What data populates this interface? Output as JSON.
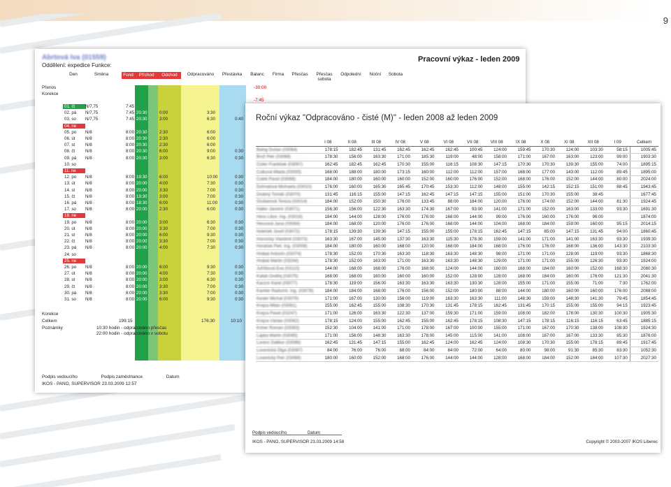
{
  "page": {
    "number": "9"
  },
  "back_doc": {
    "name": "Abrtová Iva (01559)",
    "department": "Oddělení: expedice Funkce:",
    "title": "Pracovní výkaz - leden 2009",
    "headers": [
      "Den",
      "Směna",
      "Fond",
      "Příchod",
      "Odchod",
      "Odpracováno",
      "Přestávka",
      "Balanc",
      "Firma",
      "Přesčas",
      "Přesčas sobota",
      "Odpolední",
      "Noční",
      "Sobota"
    ],
    "prenos_label": "Přenos",
    "korekce_label": "Korekce",
    "balance_1": "-30:00",
    "balance_2": "-7:45",
    "rows": [
      {
        "day": "01. čt",
        "shift": "N/7,75",
        "fond": "7:45",
        "arr": "",
        "dep": "",
        "work": "",
        "pause": "",
        "type": "green"
      },
      {
        "day": "02. pá",
        "shift": "N/7,75",
        "fond": "7:45",
        "arr": "20:30",
        "dep": "0:00",
        "work": "3:30",
        "pause": "",
        "type": ""
      },
      {
        "day": "03. so",
        "shift": "N/7,75",
        "fond": "7:45",
        "arr": "20:30",
        "dep": "3:00",
        "work": "6:30",
        "pause": "0:40",
        "type": ""
      },
      {
        "day": "04. ne",
        "shift": "",
        "fond": "",
        "arr": "",
        "dep": "",
        "work": "",
        "pause": "",
        "type": "hol"
      },
      {
        "day": "05. po",
        "shift": "N/8",
        "fond": "8:00",
        "arr": "20:30",
        "dep": "2:30",
        "work": "6:00",
        "pause": "",
        "type": ""
      },
      {
        "day": "06. út",
        "shift": "N/8",
        "fond": "8:00",
        "arr": "20:30",
        "dep": "2:30",
        "work": "6:00",
        "pause": "",
        "type": ""
      },
      {
        "day": "07. st",
        "shift": "N/8",
        "fond": "8:00",
        "arr": "20:30",
        "dep": "2:30",
        "work": "6:00",
        "pause": "",
        "type": ""
      },
      {
        "day": "08. čt",
        "shift": "N/8",
        "fond": "8:00",
        "arr": "20:30",
        "dep": "6:00",
        "work": "9:00",
        "pause": "0:30",
        "type": ""
      },
      {
        "day": "09. pá",
        "shift": "N/8",
        "fond": "8:00",
        "arr": "20:30",
        "dep": "3:00",
        "work": "6:30",
        "pause": "0:30",
        "type": ""
      },
      {
        "day": "10. so",
        "shift": "",
        "fond": "",
        "arr": "",
        "dep": "",
        "work": "",
        "pause": "",
        "type": ""
      },
      {
        "day": "11. ne",
        "shift": "",
        "fond": "",
        "arr": "",
        "dep": "",
        "work": "",
        "pause": "",
        "type": "hol"
      },
      {
        "day": "12. po",
        "shift": "N/8",
        "fond": "8:00",
        "arr": "19:30",
        "dep": "6:00",
        "work": "10:00",
        "pause": "0:30",
        "type": ""
      },
      {
        "day": "13. út",
        "shift": "N/8",
        "fond": "8:00",
        "arr": "20:00",
        "dep": "4:00",
        "work": "7:30",
        "pause": "0:30",
        "type": ""
      },
      {
        "day": "14. st",
        "shift": "N/8",
        "fond": "8:00",
        "arr": "20:00",
        "dep": "3:30",
        "work": "7:00",
        "pause": "0:30",
        "type": ""
      },
      {
        "day": "15. čt",
        "shift": "N/8",
        "fond": "8:00",
        "arr": "19:30",
        "dep": "3:00",
        "work": "7:00",
        "pause": "0:30",
        "type": ""
      },
      {
        "day": "16. pá",
        "shift": "N/8",
        "fond": "8:00",
        "arr": "18:30",
        "dep": "6:00",
        "work": "11:00",
        "pause": "0:30",
        "type": ""
      },
      {
        "day": "17. so",
        "shift": "N/8",
        "fond": "8:00",
        "arr": "20:00",
        "dep": "2:30",
        "work": "6:00",
        "pause": "0:30",
        "type": ""
      },
      {
        "day": "18. ne",
        "shift": "",
        "fond": "",
        "arr": "",
        "dep": "",
        "work": "",
        "pause": "",
        "type": "hol"
      },
      {
        "day": "19. po",
        "shift": "N/8",
        "fond": "8:00",
        "arr": "20:00",
        "dep": "3:00",
        "work": "6:30",
        "pause": "0:30",
        "type": ""
      },
      {
        "day": "20. út",
        "shift": "N/8",
        "fond": "8:00",
        "arr": "20:00",
        "dep": "3:30",
        "work": "7:00",
        "pause": "0:30",
        "type": ""
      },
      {
        "day": "21. st",
        "shift": "N/8",
        "fond": "8:00",
        "arr": "20:00",
        "dep": "6:00",
        "work": "9:30",
        "pause": "0:30",
        "type": ""
      },
      {
        "day": "22. čt",
        "shift": "N/8",
        "fond": "8:00",
        "arr": "20:00",
        "dep": "3:30",
        "work": "7:00",
        "pause": "0:30",
        "type": ""
      },
      {
        "day": "23. pá",
        "shift": "N/8",
        "fond": "8:00",
        "arr": "20:00",
        "dep": "4:00",
        "work": "7:30",
        "pause": "0:30",
        "type": ""
      },
      {
        "day": "24. so",
        "shift": "",
        "fond": "",
        "arr": "",
        "dep": "",
        "work": "",
        "pause": "",
        "type": ""
      },
      {
        "day": "25. ne",
        "shift": "",
        "fond": "",
        "arr": "",
        "dep": "",
        "work": "",
        "pause": "",
        "type": "hol"
      },
      {
        "day": "26. po",
        "shift": "N/8",
        "fond": "8:00",
        "arr": "20:00",
        "dep": "6:00",
        "work": "9:30",
        "pause": "0:30",
        "type": ""
      },
      {
        "day": "27. út",
        "shift": "N/8",
        "fond": "8:00",
        "arr": "20:00",
        "dep": "4:00",
        "work": "7:30",
        "pause": "0:30",
        "type": ""
      },
      {
        "day": "28. st",
        "shift": "N/8",
        "fond": "8:00",
        "arr": "20:00",
        "dep": "3:00",
        "work": "6:30",
        "pause": "0:30",
        "type": ""
      },
      {
        "day": "29. čt",
        "shift": "N/8",
        "fond": "8:00",
        "arr": "20:00",
        "dep": "3:30",
        "work": "7:00",
        "pause": "0:30",
        "type": ""
      },
      {
        "day": "30. pá",
        "shift": "N/8",
        "fond": "8:00",
        "arr": "20:00",
        "dep": "3:30",
        "work": "7:00",
        "pause": "0:30",
        "type": ""
      },
      {
        "day": "31. so",
        "shift": "N/8",
        "fond": "8:00",
        "arr": "20:00",
        "dep": "6:00",
        "work": "9:30",
        "pause": "0:30",
        "type": ""
      }
    ],
    "korekce2_label": "Korekce",
    "celkem_label": "Celkem",
    "celkem_fond": "199:15",
    "celkem_work": "176:30",
    "celkem_pause": "10:10",
    "poznamky_label": "Poznámky",
    "note_1": "10:30 hodin - odpracováno přesčas",
    "note_2": "22:00 hodin - odpracováno v sobotu",
    "sign_manager": "Podpis vedoucího",
    "sign_employee": "Podpis zaměstnance",
    "sign_date": "Datum",
    "footer": "IKOS - PANO, SUPERVISOR 23.03.2009 12:57"
  },
  "front_doc": {
    "title": "Roční výkaz \"Odpracováno - čisté (M)\" - leden 2008 až leden 2009",
    "columns": [
      "",
      "I 08",
      "II 08",
      "III 08",
      "IV 08",
      "V 08",
      "VI 08",
      "VII 08",
      "VIII 08",
      "IX 08",
      "X 08",
      "XI 08",
      "XII 08",
      "I 09",
      "Celkem"
    ],
    "rows": [
      [
        "Balog Dušan (03064)",
        "178:15",
        "182:45",
        "131:45",
        "162:45",
        "162:45",
        "162:45",
        "100:45",
        "124:00",
        "159:45",
        "170:30",
        "124:00",
        "103:30",
        "58:15",
        "1005:45"
      ],
      [
        "Brož Petr (03066)",
        "178:30",
        "156:00",
        "163:30",
        "171:00",
        "185:30",
        "119:00",
        "48:00",
        "158:00",
        "171:00",
        "167:00",
        "163:00",
        "123:00",
        "99:00",
        "1903:30"
      ],
      [
        "Cizler František (03067)",
        "162:45",
        "182:45",
        "162:45",
        "170:30",
        "155:00",
        "116:15",
        "108:30",
        "147:15",
        "170:30",
        "170:30",
        "139:30",
        "155:00",
        "74:00",
        "1895:15"
      ],
      [
        "Culková Mlada (03005)",
        "168:00",
        "188:00",
        "180:00",
        "173:15",
        "160:00",
        "112:00",
        "112:00",
        "157:00",
        "168:00",
        "177:00",
        "143:00",
        "112:00",
        "89:45",
        "1895:00"
      ],
      [
        "Culek Pavel (03068)",
        "184:00",
        "180:00",
        "160:00",
        "160:00",
        "152:00",
        "160:00",
        "176:00",
        "152:00",
        "168:00",
        "176:00",
        "152:00",
        "144:00",
        "80:00",
        "2024:00"
      ],
      [
        "Dohnalová Michaela (03010)",
        "176:00",
        "160:00",
        "165:30",
        "165:45",
        "170:45",
        "153:30",
        "112:00",
        "148:00",
        "155:00",
        "142:15",
        "152:15",
        "151:00",
        "88:45",
        "1943:45"
      ],
      [
        "Drobný Tomáš (03070)",
        "131:45",
        "116:15",
        "155:00",
        "147:15",
        "162:45",
        "147:15",
        "147:15",
        "155:00",
        "151:00",
        "170:30",
        "155:00",
        "38:45",
        "",
        "1677:45"
      ],
      [
        "Grubarová Tereza (03014)",
        "184:00",
        "152:00",
        "150:30",
        "176:00",
        "133:45",
        "88:00",
        "184:00",
        "120:00",
        "176:00",
        "174:00",
        "152:00",
        "144:00",
        "81:30",
        "1924:45"
      ],
      [
        "Haller Jaromír (03071)",
        "156:30",
        "156:00",
        "122:30",
        "163:30",
        "174:30",
        "167:00",
        "93:00",
        "141:00",
        "171:00",
        "152:00",
        "163:00",
        "133:00",
        "93:30",
        "1691:30"
      ],
      [
        "Hess Libor, Ing. (03016)",
        "184:00",
        "144:00",
        "128:00",
        "176:00",
        "176:00",
        "168:00",
        "144:00",
        "99:00",
        "176:00",
        "160:00",
        "176:00",
        "96:00",
        "",
        "1874:00"
      ],
      [
        "Hessová Jana (03084)",
        "184:00",
        "168:00",
        "120:00",
        "176:00",
        "176:00",
        "168:00",
        "144:00",
        "104:00",
        "168:00",
        "184:00",
        "159:00",
        "160:00",
        "95:15",
        "2014:15"
      ],
      [
        "Holeček Josef (03072)",
        "178:15",
        "139:30",
        "139:30",
        "147:15",
        "155:00",
        "155:00",
        "178:15",
        "162:45",
        "147:15",
        "85:00",
        "147:15",
        "131:45",
        "94:00",
        "1860:45"
      ],
      [
        "Honzický Vlastimil (03073)",
        "163:30",
        "167:00",
        "145:00",
        "137:30",
        "163:30",
        "115:30",
        "178:30",
        "159:00",
        "141:00",
        "171:00",
        "141:00",
        "163:30",
        "93:30",
        "1939:30"
      ],
      [
        "Horáček Petr, Ing. (03008)",
        "184:00",
        "180:00",
        "160:00",
        "168:00",
        "120:00",
        "168:00",
        "184:00",
        "168:00",
        "176:00",
        "176:00",
        "168:00",
        "136:00",
        "143:30",
        "2103:30"
      ],
      [
        "Hrabal Antonín (03074)",
        "178:30",
        "152:00",
        "170:30",
        "163:30",
        "118:30",
        "163:30",
        "148:30",
        "98:00",
        "171:00",
        "171:00",
        "128:00",
        "119:00",
        "93:30",
        "1868:30"
      ],
      [
        "Hrabal Martin (03244)",
        "178:30",
        "152:00",
        "163:00",
        "171:00",
        "163:30",
        "163:30",
        "148:30",
        "129:00",
        "171:00",
        "171:00",
        "155:00",
        "126:30",
        "93:30",
        "1924:00"
      ],
      [
        "Juříčková Eva (03110)",
        "144:00",
        "168:00",
        "168:00",
        "176:00",
        "168:00",
        "124:00",
        "144:00",
        "160:00",
        "168:00",
        "184:00",
        "160:00",
        "152:00",
        "168:30",
        "2080:30"
      ],
      [
        "Kabát Ondřej (03075)",
        "168:00",
        "168:00",
        "160:00",
        "160:00",
        "160:00",
        "152:00",
        "128:00",
        "128:00",
        "168:00",
        "184:00",
        "160:00",
        "176:00",
        "121:30",
        "2041:30"
      ],
      [
        "Kaczor Karel (03077)",
        "178:30",
        "119:00",
        "156:00",
        "163:30",
        "163:30",
        "163:30",
        "130:30",
        "128:00",
        "155:00",
        "171:00",
        "155:00",
        "71:00",
        "7:30",
        "1762:00"
      ],
      [
        "Kamler Radomír, Ing. (03078)",
        "184:00",
        "184:00",
        "168:00",
        "176:00",
        "156:00",
        "152:00",
        "180:00",
        "88:00",
        "144:00",
        "180:00",
        "160:00",
        "160:00",
        "176:00",
        "2088:00"
      ],
      [
        "Kesler Michal (03079)",
        "171:00",
        "167:00",
        "130:00",
        "156:00",
        "119:00",
        "163:30",
        "163:30",
        "111:00",
        "148:30",
        "159:00",
        "148:30",
        "141:30",
        "79:45",
        "1854:45"
      ],
      [
        "Krejza Milan (03081)",
        "155:00",
        "162:45",
        "155:00",
        "108:30",
        "170:30",
        "131:45",
        "178:15",
        "162:45",
        "131:45",
        "170:15",
        "155:00",
        "155:00",
        "94:15",
        "1923:45"
      ],
      [
        "Krejza Pavel (03247)",
        "171:00",
        "126:00",
        "163:30",
        "122:30",
        "137:00",
        "159:30",
        "171:00",
        "159:00",
        "108:00",
        "182:00",
        "178:00",
        "130:30",
        "100:30",
        "1905:30"
      ],
      [
        "Krejza Václav (03082)",
        "178:15",
        "124:00",
        "155:00",
        "162:45",
        "155:00",
        "162:45",
        "178:15",
        "108:30",
        "147:15",
        "178:15",
        "116:15",
        "116:15",
        "63:45",
        "1885:15"
      ],
      [
        "Kriner Roman (03083)",
        "152:30",
        "104:00",
        "141:00",
        "171:00",
        "178:00",
        "167:00",
        "100:00",
        "155:00",
        "171:00",
        "167:00",
        "170:30",
        "138:00",
        "108:30",
        "1924:30"
      ],
      [
        "Lapka Martin (03085)",
        "171:00",
        "156:00",
        "148:30",
        "163:30",
        "178:00",
        "145:00",
        "115:00",
        "141:00",
        "108:00",
        "167:00",
        "167:00",
        "133:30",
        "85:30",
        "1876:00"
      ],
      [
        "Lorenc Dalibor (03086)",
        "162:45",
        "131:45",
        "147:15",
        "155:00",
        "162:45",
        "124:00",
        "162:45",
        "124:00",
        "108:30",
        "170:30",
        "155:00",
        "178:15",
        "89:45",
        "1917:45"
      ],
      [
        "Losenická Olga (03087)",
        "84:00",
        "76:00",
        "76:00",
        "88:00",
        "84:00",
        "84:00",
        "72:00",
        "64:00",
        "80:00",
        "98:00",
        "91:30",
        "85:30",
        "83:30",
        "1052:30"
      ],
      [
        "Losenický Petr (03088)",
        "180:00",
        "160:00",
        "152:00",
        "168:00",
        "176:00",
        "144:00",
        "144:00",
        "128:00",
        "168:00",
        "184:00",
        "152:00",
        "184:00",
        "107:30",
        "2027:30"
      ]
    ],
    "sign_manager": "Podpis vedoucího",
    "sign_date": "Datum",
    "footer": "IKOS - PANO, SUPERVISOR 23.03.2009 14:58",
    "copyright": "Copyright © 2003-2007 IKOS Liberec"
  }
}
